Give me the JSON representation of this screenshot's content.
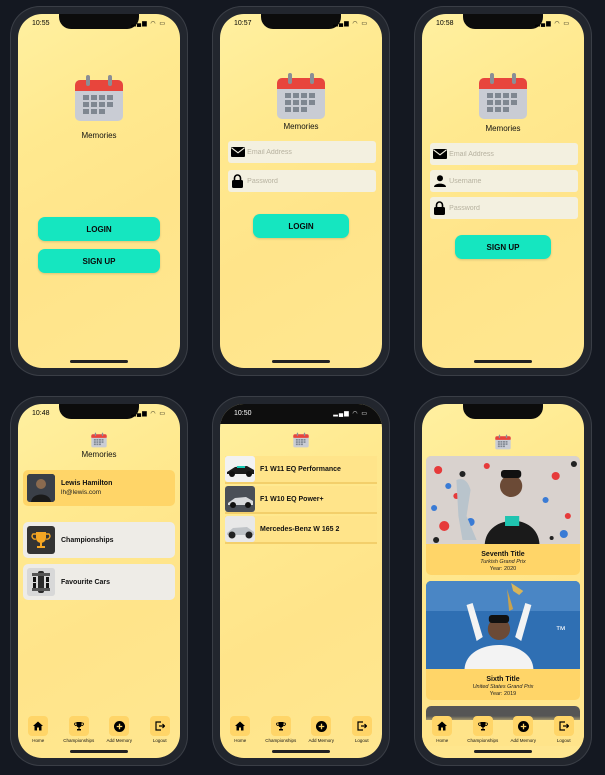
{
  "app_name": "Memories",
  "screens": {
    "welcome": {
      "time": "10:55",
      "login_label": "LOGIN",
      "signup_label": "SIGN UP"
    },
    "login": {
      "time": "10:57",
      "email_placeholder": "Email Address",
      "password_placeholder": "Password",
      "login_label": "LOGIN"
    },
    "signup": {
      "time": "10:58",
      "email_placeholder": "Email Address",
      "username_placeholder": "Username",
      "password_placeholder": "Password",
      "signup_label": "SIGN UP"
    },
    "home": {
      "time": "10:48",
      "profile": {
        "name": "Lewis Hamilton",
        "email": "lh@lewis.com"
      },
      "items": [
        {
          "label": "Championships"
        },
        {
          "label": "Favourite Cars"
        }
      ]
    },
    "cars": {
      "time": "10:50",
      "cars": [
        {
          "name": "F1 W11 EQ Performance"
        },
        {
          "name": "F1 W10 EQ Power+"
        },
        {
          "name": "Mercedes-Benz W 165 2"
        }
      ]
    },
    "championships": {
      "titles": [
        {
          "title": "Seventh Title",
          "grand_prix": "Turkish Grand Prix",
          "year": "Year: 2020"
        },
        {
          "title": "Sixth Title",
          "grand_prix": "United States Grand Prix",
          "year": "Year: 2019"
        }
      ]
    }
  },
  "tabbar": {
    "home": "Home",
    "championships": "Championships",
    "add_memory": "Add Memory",
    "logout": "Logout"
  },
  "colors": {
    "accent": "#15e6c0",
    "card": "#ffd568",
    "background": "#ffe98f"
  },
  "icons": [
    "calendar-icon",
    "mail-icon",
    "lock-icon",
    "person-icon",
    "trophy-icon",
    "home-icon",
    "plus-icon",
    "logout-icon",
    "car-icon"
  ]
}
